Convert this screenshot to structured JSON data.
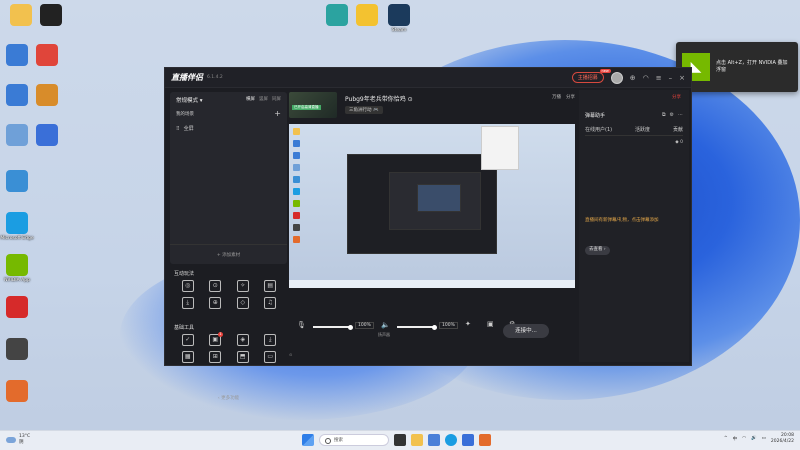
{
  "desktop": {
    "top_icons": [
      {
        "label": "",
        "icon": "folder-icon",
        "color": "#f2c14e"
      },
      {
        "label": "",
        "icon": "logitech-icon",
        "color": "#222222"
      },
      {
        "label": "",
        "icon": "app-icon",
        "color": "#2ba3a0"
      },
      {
        "label": "",
        "icon": "game-icon",
        "color": "#f3c230"
      },
      {
        "label": "Steam",
        "icon": "steam-icon",
        "color": "#1b3a5c"
      }
    ],
    "left_icons": [
      {
        "label": "",
        "icon": "pc-icon",
        "color": "#3a7bd5"
      },
      {
        "label": "",
        "icon": "app-icon",
        "color": "#e0453a"
      },
      {
        "label": "",
        "icon": "network-icon",
        "color": "#3a7bd5"
      },
      {
        "label": "",
        "icon": "app-icon",
        "color": "#d88c2a"
      },
      {
        "label": "",
        "icon": "recycle-bin-icon",
        "color": "#6fa0d8"
      },
      {
        "label": "",
        "icon": "app-icon",
        "color": "#3a6fd8"
      },
      {
        "label": "",
        "icon": "control-panel-icon",
        "color": "#3a8fd5"
      },
      {
        "label": "Microsoft Edge",
        "icon": "edge-icon",
        "color": "#1b9de2"
      },
      {
        "label": "NVIDIA App",
        "icon": "nvidia-icon",
        "color": "#76b900"
      },
      {
        "label": "",
        "icon": "app-icon",
        "color": "#d62a2a"
      },
      {
        "label": "",
        "icon": "app-icon",
        "color": "#444444"
      },
      {
        "label": "",
        "icon": "app-icon",
        "color": "#e36b2c"
      }
    ]
  },
  "toast": {
    "message": "点击 Alt+Z，打开 NVIDIA 叠加浮窗"
  },
  "app": {
    "brand": "直播伴侣",
    "version": "6.1.4.2",
    "upgrade_label": "主播招募",
    "upgrade_badge": "new",
    "left": {
      "mode_label": "常规模式",
      "tabs": [
        "横屏",
        "竖屏",
        "同屏"
      ],
      "my_scenes": "我的场景",
      "scene_item": "全屏",
      "add_source": "添加素材",
      "interact_title": "互动玩法",
      "interact_tools": [
        "",
        "",
        "",
        "",
        "",
        "",
        "",
        ""
      ],
      "basic_title": "基础工具",
      "basic_tools": [
        "",
        "",
        "",
        "",
        "",
        "",
        "",
        ""
      ],
      "basic_badge": "1",
      "more": "更多功能"
    },
    "room": {
      "title": "Pubg9年老兵带你恰鸡",
      "thumb_tag": "已开启高清直播",
      "category_prefix": "三角洲行动",
      "stats": [
        "万播",
        "分享"
      ],
      "tools": [
        ""
      ],
      "pk": ""
    },
    "controls": {
      "mic_label": "",
      "mic_pct": "100%",
      "spk_label": "扬声器",
      "spk_pct": "100%",
      "icons": [
        "",
        "",
        ""
      ],
      "go_live": "连接中..."
    },
    "status": {
      "left": "",
      "right": [
        ""
      ]
    },
    "right": {
      "top": [
        "",
        "",
        "分享"
      ],
      "header": "弹幕助手",
      "tabs": [
        "在线用户(1)",
        "活跃度",
        "贡献"
      ],
      "msg1": "",
      "badge": "0",
      "msg2": "",
      "hl1": "直播间有新弹幕/礼物，点击弹幕添加",
      "hl2": "",
      "btn": "去查看 ›",
      "msg3": ""
    }
  },
  "taskbar": {
    "weather_temp": "13°C",
    "weather_desc": "阴",
    "search": "搜索",
    "time": "20:08",
    "date": "2026/4/22",
    "ime": "中"
  }
}
